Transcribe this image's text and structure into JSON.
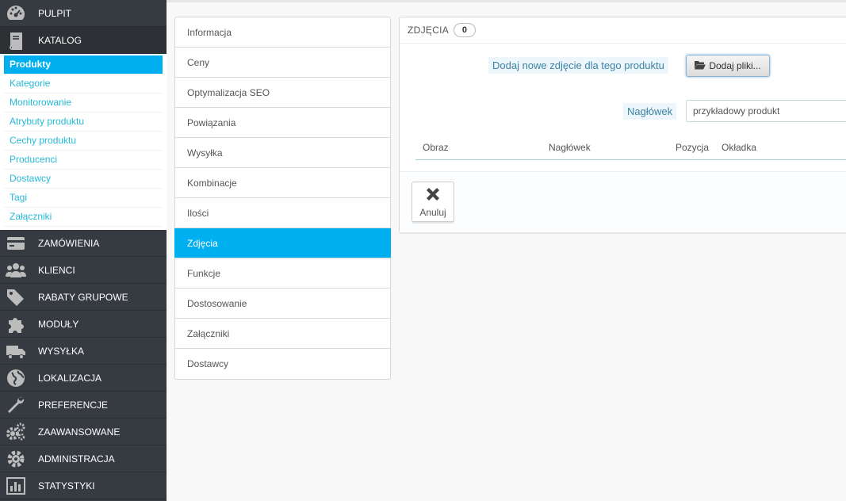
{
  "sidebar": {
    "top_items": [
      {
        "label": "PULPIT",
        "icon": "dashboard-icon"
      },
      {
        "label": "KATALOG",
        "icon": "book-icon"
      }
    ],
    "catalog_submenu": [
      "Produkty",
      "Kategorie",
      "Monitorowanie",
      "Atrybuty produktu",
      "Cechy produktu",
      "Producenci",
      "Dostawcy",
      "Tagi",
      "Załączniki"
    ],
    "items": [
      {
        "label": "ZAMÓWIENIA",
        "icon": "credit-card-icon"
      },
      {
        "label": "KLIENCI",
        "icon": "users-icon"
      },
      {
        "label": "RABATY GRUPOWE",
        "icon": "tags-icon"
      },
      {
        "label": "MODUŁY",
        "icon": "puzzle-icon"
      },
      {
        "label": "WYSYŁKA",
        "icon": "truck-icon"
      },
      {
        "label": "LOKALIZACJA",
        "icon": "globe-icon"
      },
      {
        "label": "PREFERENCJE",
        "icon": "wrench-icon"
      },
      {
        "label": "ZAAWANSOWANE",
        "icon": "cogs-icon"
      },
      {
        "label": "ADMINISTRACJA",
        "icon": "cog-icon"
      },
      {
        "label": "STATYSTYKI",
        "icon": "bar-chart-icon"
      }
    ]
  },
  "tabs": [
    "Informacja",
    "Ceny",
    "Optymalizacja SEO",
    "Powiązania",
    "Wysyłka",
    "Kombinacje",
    "Ilości",
    "Zdjęcia",
    "Funkcje",
    "Dostosowanie",
    "Załączniki",
    "Dostawcy"
  ],
  "active_tab": "Zdjęcia",
  "panel": {
    "title": "ZDJĘCIA",
    "count": "0",
    "add_label": "Dodaj nowe zdjęcie dla tego produktu",
    "add_button": "Dodaj pliki...",
    "caption_label": "Nagłówek",
    "caption_value": "przykładowy produkt",
    "columns": [
      "Obraz",
      "Nagłówek",
      "Pozycja",
      "Okładka"
    ],
    "cancel_button": "Anuluj"
  },
  "colors": {
    "sidebar_bg": "#363a41",
    "accent": "#00aff0",
    "link": "#25b9d7"
  }
}
